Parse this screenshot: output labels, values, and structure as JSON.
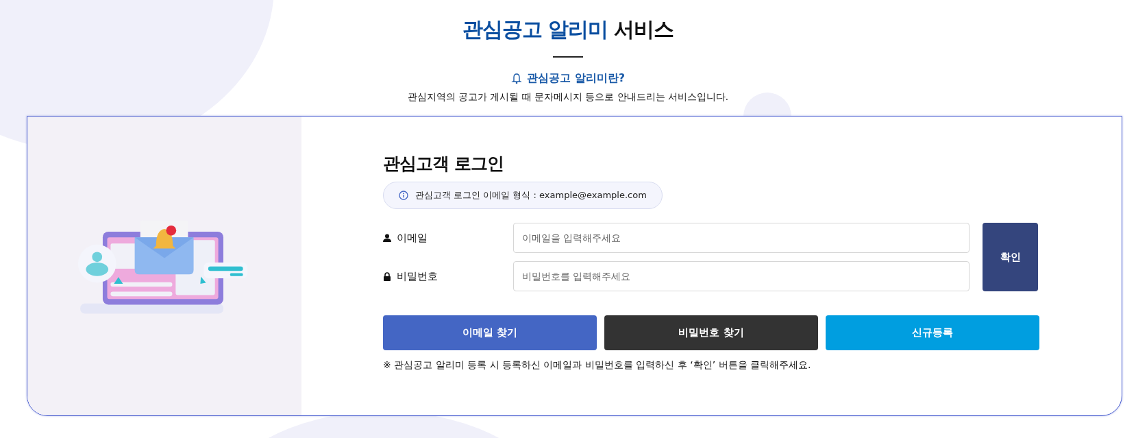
{
  "header": {
    "title_highlight": "관심공고 알리미",
    "title_rest": "서비스",
    "subtitle": "관심공고 알리미란?",
    "description": "관심지역의 공고가 게시될 때 문자메시지 등으로 안내드리는 서비스입니다."
  },
  "login": {
    "title": "관심고객 로그인",
    "info": "관심고객 로그인 이메일 형식 : example@example.com",
    "fields": [
      {
        "kind": "user",
        "label": "이메일",
        "placeholder": "이메일을 입력해주세요"
      },
      {
        "kind": "lock",
        "label": "비밀번호",
        "placeholder": "비밀번호를 입력해주세요"
      }
    ],
    "confirm": "확인",
    "buttons": [
      {
        "label": "이메일 찾기",
        "color": "#4466c4"
      },
      {
        "label": "비밀번호 찾기",
        "color": "#333333"
      },
      {
        "label": "신규등록",
        "color": "#009ee0"
      }
    ],
    "note": "※  관심공고 알리미 등록 시 등록하신 이메일과 비밀번호를 입력하신 후 ‘확인’ 버튼을 클릭해주세요."
  }
}
